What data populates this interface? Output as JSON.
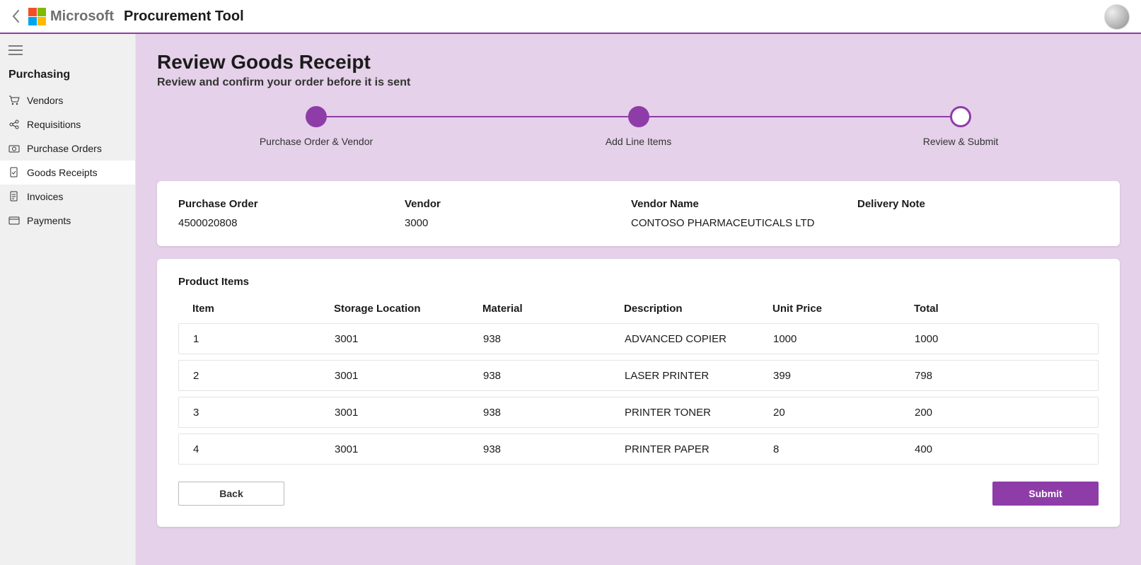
{
  "header": {
    "ms_word": "Microsoft",
    "app_title": "Procurement Tool"
  },
  "sidebar": {
    "group_title": "Purchasing",
    "items": [
      {
        "label": "Vendors",
        "icon": "cart-icon",
        "active": false
      },
      {
        "label": "Requisitions",
        "icon": "share-icon",
        "active": false
      },
      {
        "label": "Purchase Orders",
        "icon": "camera-icon",
        "active": false
      },
      {
        "label": "Goods Receipts",
        "icon": "doc-check-icon",
        "active": true
      },
      {
        "label": "Invoices",
        "icon": "doc-icon",
        "active": false
      },
      {
        "label": "Payments",
        "icon": "card-icon",
        "active": false
      }
    ]
  },
  "page": {
    "title": "Review Goods Receipt",
    "subtitle": "Review and confirm your order before it is sent"
  },
  "stepper": {
    "steps": [
      {
        "label": "Purchase Order & Vendor",
        "state": "done"
      },
      {
        "label": "Add Line Items",
        "state": "done"
      },
      {
        "label": "Review & Submit",
        "state": "current"
      }
    ]
  },
  "summary": {
    "purchase_order": {
      "label": "Purchase Order",
      "value": "4500020808"
    },
    "vendor": {
      "label": "Vendor",
      "value": "3000"
    },
    "vendor_name": {
      "label": "Vendor Name",
      "value": "CONTOSO PHARMACEUTICALS LTD"
    },
    "delivery_note": {
      "label": "Delivery Note",
      "value": ""
    }
  },
  "items": {
    "title": "Product Items",
    "headers": [
      "Item",
      "Storage Location",
      "Material",
      "Description",
      "Unit Price",
      "Total"
    ],
    "rows": [
      {
        "item": "1",
        "storage": "3001",
        "material": "938",
        "description": "ADVANCED COPIER",
        "unit_price": "1000",
        "total": "1000"
      },
      {
        "item": "2",
        "storage": "3001",
        "material": "938",
        "description": "LASER PRINTER",
        "unit_price": "399",
        "total": "798"
      },
      {
        "item": "3",
        "storage": "3001",
        "material": "938",
        "description": "PRINTER TONER",
        "unit_price": "20",
        "total": "200"
      },
      {
        "item": "4",
        "storage": "3001",
        "material": "938",
        "description": "PRINTER PAPER",
        "unit_price": "8",
        "total": "400"
      }
    ]
  },
  "actions": {
    "back": "Back",
    "submit": "Submit"
  }
}
